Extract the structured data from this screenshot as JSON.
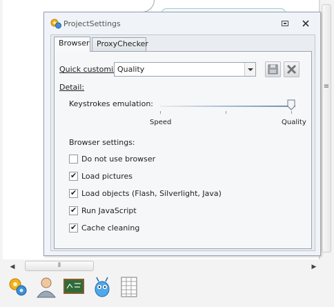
{
  "dialog": {
    "title": "ProjectSettings",
    "tabs": [
      {
        "label": "Browser",
        "active": true
      },
      {
        "label": "ProxyChecker",
        "active": false
      }
    ]
  },
  "browser_tab": {
    "quick_customize_label": "Quick customize:",
    "quick_customize_value": "Quality",
    "detail_label": "Detail:",
    "keystrokes_label": "Keystrokes emulation:",
    "keystrokes_min_label": "Speed",
    "keystrokes_max_label": "Quality",
    "keystrokes_level": 1.0,
    "browser_settings_label": "Browser settings:",
    "checkboxes": [
      {
        "label": "Do not use browser",
        "checked": false
      },
      {
        "label": "Load pictures",
        "checked": true
      },
      {
        "label": "Load objects (Flash, Silverlight, Java)",
        "checked": true
      },
      {
        "label": "Run JavaScript",
        "checked": true
      },
      {
        "label": "Cache cleaning",
        "checked": true
      }
    ]
  },
  "icons": {
    "title": "gears-icon",
    "restore": "restore-icon",
    "close": "close-icon",
    "save": "floppy-disk-icon",
    "delete": "x-delete-icon",
    "toolbar": [
      "gears-icon",
      "user-icon",
      "chalkboard-icon",
      "robot-icon",
      "spreadsheet-icon"
    ]
  },
  "colors": {
    "dialog_bg": "#f0f3f7",
    "panel_bg": "#f5f7f9",
    "border": "#9aa3ad"
  }
}
